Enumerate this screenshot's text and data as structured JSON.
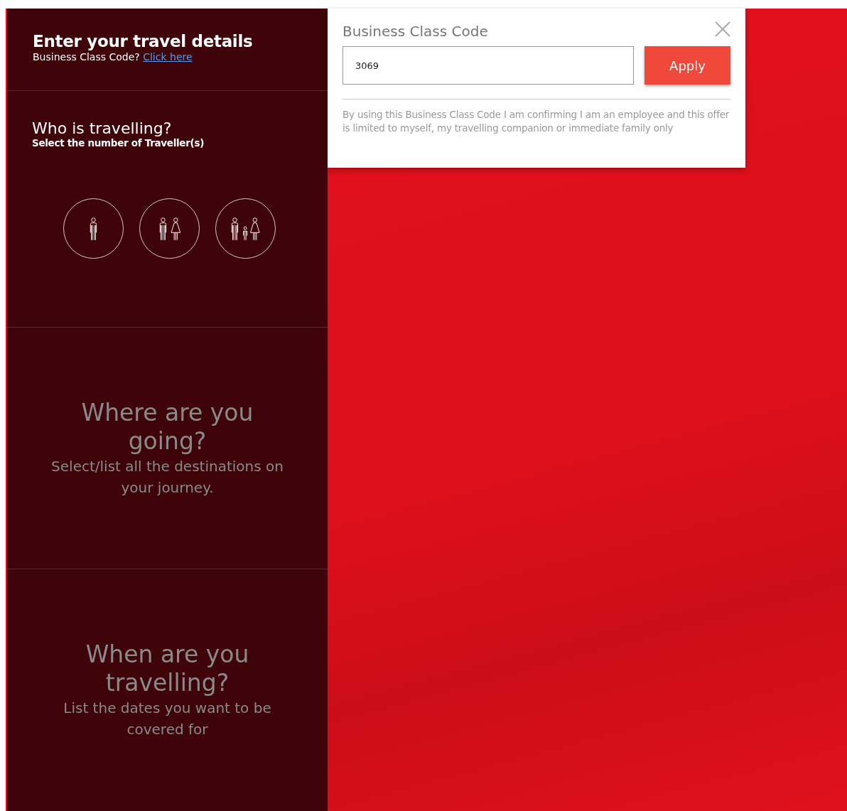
{
  "header": {
    "title": "Enter your travel details",
    "code_prompt": "Business Class Code?",
    "code_link": "Click here"
  },
  "travellers": {
    "title": "Who is travelling?",
    "subtitle": "Select the number of Traveller(s)",
    "options": [
      {
        "kind": "single",
        "selected": false
      },
      {
        "kind": "couple",
        "selected": false
      },
      {
        "kind": "family",
        "selected": false
      }
    ]
  },
  "sections": [
    {
      "title": "Where are you going?",
      "subtitle": "Select/list all the destinations on your journey."
    },
    {
      "title": "When are you travelling?",
      "subtitle": "List the dates you want to be covered for"
    }
  ],
  "code_dialog": {
    "title": "Business Class Code",
    "value": "3069",
    "apply": "Apply",
    "note": "By using this Business Class Code I am confirming I am an employee and this offer is limited to myself, my travelling companion or immediate family only"
  }
}
